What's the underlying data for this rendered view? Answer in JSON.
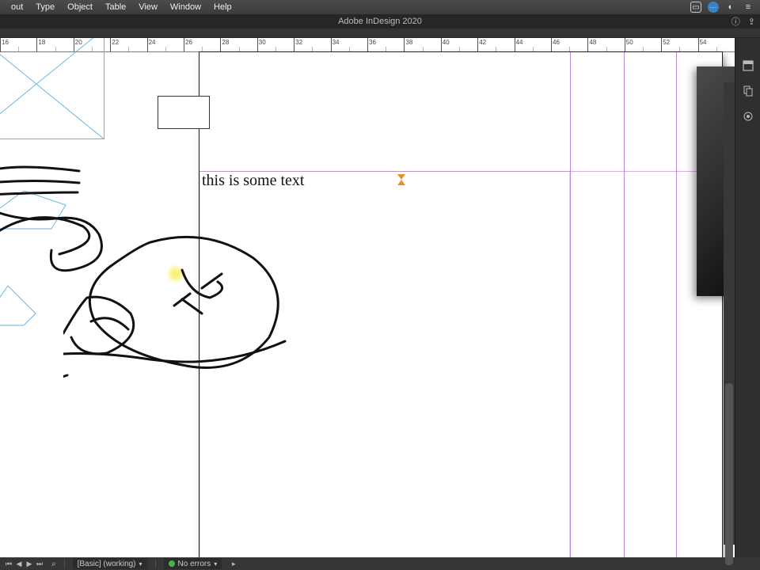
{
  "menu": {
    "items": [
      "out",
      "Type",
      "Object",
      "Table",
      "View",
      "Window",
      "Help"
    ]
  },
  "titlebar": {
    "app": "Adobe InDesign 2020"
  },
  "ruler_h": {
    "start": 16,
    "end": 56,
    "step": 2
  },
  "document": {
    "textframe": {
      "content": "this is some text"
    }
  },
  "statusbar": {
    "doc_status": "[Basic] (working)",
    "preflight": "No errors"
  }
}
